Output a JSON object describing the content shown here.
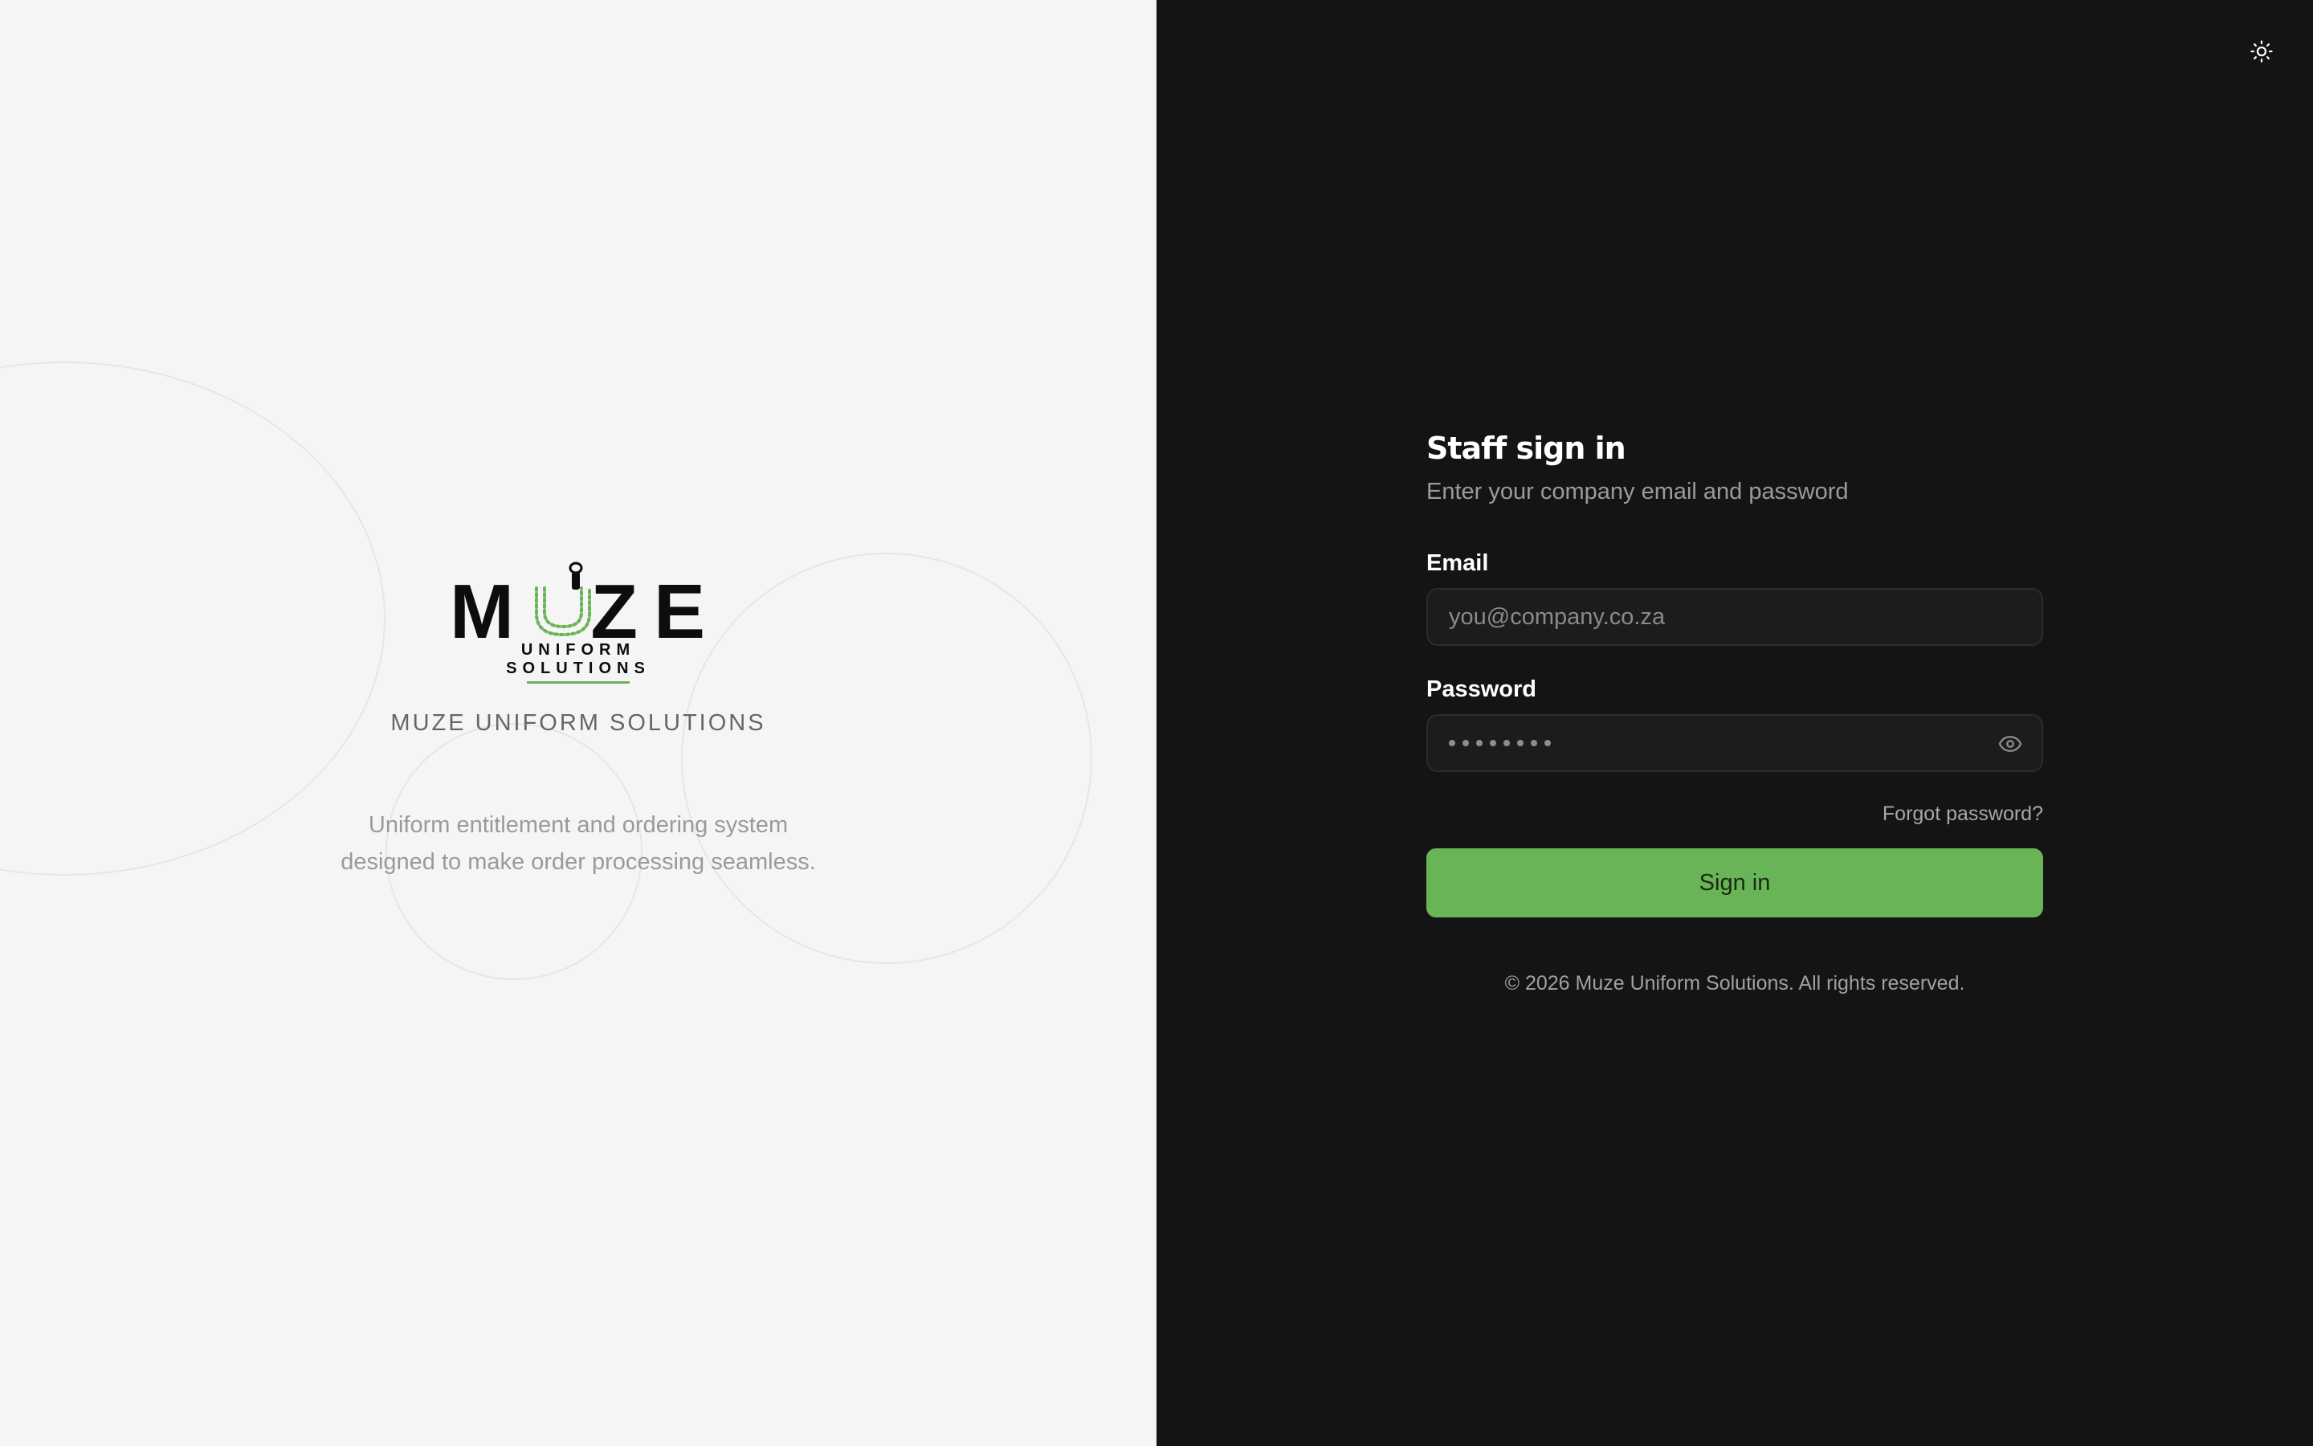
{
  "brand": {
    "logo_text": "MUZE",
    "logo_letters": [
      "M",
      "Z",
      "E"
    ],
    "logo_tagline": "UNIFORM SOLUTIONS",
    "name": "MUZE UNIFORM SOLUTIONS",
    "tagline_line1": "Uniform entitlement and ordering system",
    "tagline_line2": "designed to make order processing seamless.",
    "accent_color": "#6ab458"
  },
  "header": {
    "theme_toggle_icon": "sun-icon"
  },
  "form": {
    "title": "Staff sign in",
    "subtitle": "Enter your company email and password",
    "email_label": "Email",
    "email_placeholder": "you@company.co.za",
    "password_label": "Password",
    "password_mask": "••••••••",
    "password_visibility_icon": "eye-icon",
    "forgot_password": "Forgot password?",
    "submit_label": "Sign in"
  },
  "footer": {
    "copyright": "© 2026 Muze Uniform Solutions. All rights reserved."
  },
  "colors": {
    "left_background": "#f5f5f5",
    "right_background": "#141414",
    "input_background": "#1c1c1c",
    "button_green": "#6ab458"
  }
}
